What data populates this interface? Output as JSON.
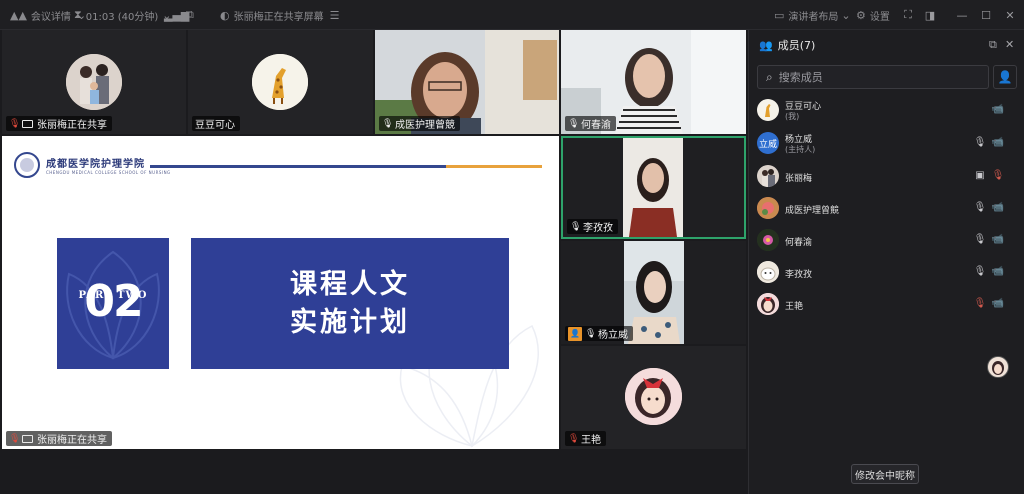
{
  "titlebar": {
    "meeting_details": "会议详情",
    "timer": "01:03 (40分钟)",
    "sharing_status": "张丽梅正在共享屏幕",
    "layout": "演讲者布局",
    "settings": "设置"
  },
  "tiles": {
    "t1_label": "张丽梅正在共享",
    "t2_label": "豆豆可心",
    "t3_label": "成医护理曾競",
    "t4_label": "何春渝",
    "t5_label": "李孜孜",
    "t6_label": "杨立威",
    "t7_label": "王艳",
    "t8_label": "张丽梅正在共享"
  },
  "slide": {
    "school_cn": "成都医学院护理学院",
    "school_en": "CHENGDU MEDICAL COLLEGE SCHOOL OF NURSING",
    "part_label": "PART TWO",
    "part_number": "02",
    "title_line1": "课程人文",
    "title_line2": "实施计划"
  },
  "panel": {
    "title": "成员(7)",
    "search_placeholder": "搜索成员",
    "rename_button": "修改会中昵称",
    "members": [
      {
        "name": "豆豆可心",
        "sub": "(我)",
        "mic": "",
        "cam": "camera-off"
      },
      {
        "name": "杨立威",
        "sub": "(主持人)",
        "avatar_text": "立威",
        "mic": "mic-on",
        "cam": "camera-on"
      },
      {
        "name": "张丽梅",
        "sub": "",
        "mic": "sharing",
        "cam": "mic-muted"
      },
      {
        "name": "成医护理曾競",
        "sub": "",
        "mic": "mic-on",
        "cam": "camera-on"
      },
      {
        "name": "何春渝",
        "sub": "",
        "mic": "mic-on",
        "cam": "camera-on"
      },
      {
        "name": "李孜孜",
        "sub": "",
        "mic": "mic-on",
        "cam": "camera-on"
      },
      {
        "name": "王艳",
        "sub": "",
        "mic": "mic-muted",
        "cam": "camera-off"
      }
    ]
  },
  "colors": {
    "slide_blue": "#2f3f96",
    "slide_orange": "#e8a23c",
    "active_border": "#2ea36b",
    "muted_red": "#e04a3c",
    "host_orange": "#e8932a"
  }
}
